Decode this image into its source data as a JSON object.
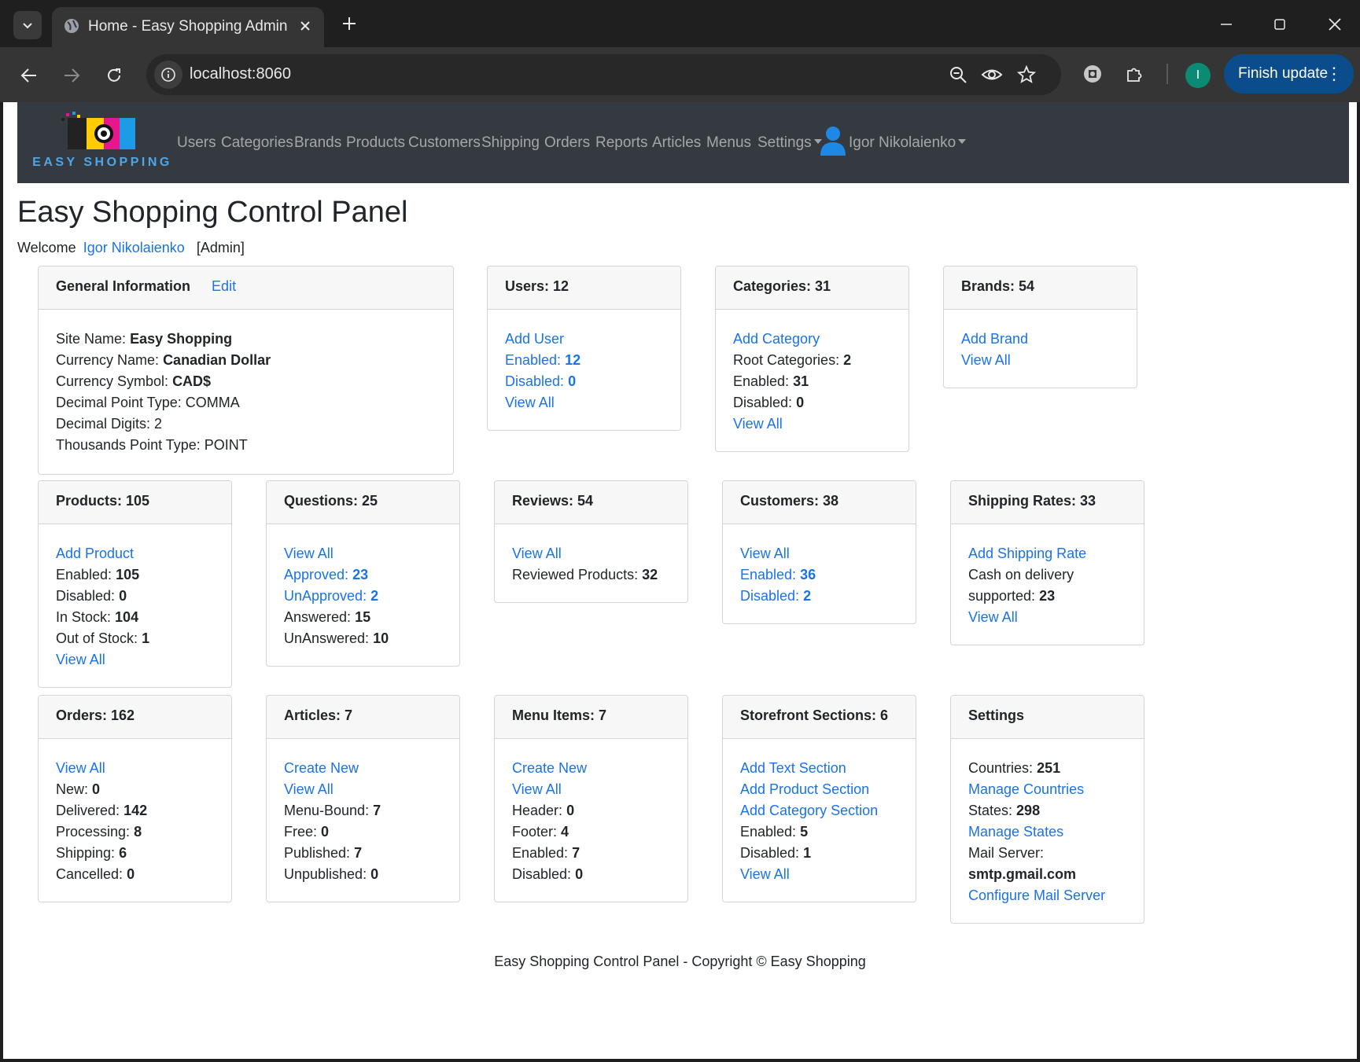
{
  "browser": {
    "tab_title": "Home - Easy Shopping Admin",
    "url": "localhost:8060",
    "profile_initial": "I",
    "finish_update": "Finish update"
  },
  "navbar": {
    "logo_text": "EASY SHOPPING",
    "items": [
      "Users",
      "Categories",
      "Brands",
      "Products",
      "Customers",
      "Shipping",
      "Orders",
      "Reports",
      "Articles",
      "Menus",
      "Settings"
    ],
    "user_name": "Igor Nikolaienko"
  },
  "page": {
    "title": "Easy Shopping Control Panel",
    "welcome_prefix": "Welcome",
    "welcome_user": "Igor Nikolaienko",
    "welcome_role": "[Admin]"
  },
  "cards": {
    "general": {
      "title": "General Information",
      "edit": "Edit",
      "site_name_label": "Site Name:",
      "site_name": "Easy Shopping",
      "currency_name_label": "Currency Name:",
      "currency_name": "Canadian Dollar",
      "currency_symbol_label": "Currency Symbol:",
      "currency_symbol": "CAD$",
      "decimal_point": "Decimal Point Type: COMMA",
      "decimal_digits": "Decimal Digits: 2",
      "thousands_point": "Thousands Point Type: POINT"
    },
    "users": {
      "title": "Users: 12",
      "add": "Add User",
      "enabled_label": "Enabled:",
      "enabled": "12",
      "disabled_label": "Disabled:",
      "disabled": "0",
      "view_all": "View All"
    },
    "categories": {
      "title": "Categories: 31",
      "add": "Add Category",
      "root_label": "Root Categories:",
      "root": "2",
      "enabled_label": "Enabled:",
      "enabled": "31",
      "disabled_label": "Disabled:",
      "disabled": "0",
      "view_all": "View All"
    },
    "brands": {
      "title": "Brands: 54",
      "add": "Add Brand",
      "view_all": "View All"
    },
    "products": {
      "title": "Products: 105",
      "add": "Add Product",
      "enabled_label": "Enabled:",
      "enabled": "105",
      "disabled_label": "Disabled:",
      "disabled": "0",
      "instock_label": "In Stock:",
      "instock": "104",
      "outstock_label": "Out of Stock:",
      "outstock": "1",
      "view_all": "View All"
    },
    "questions": {
      "title": "Questions: 25",
      "view_all": "View All",
      "approved_label": "Approved:",
      "approved": "23",
      "unapproved_label": "UnApproved:",
      "unapproved": "2",
      "answered_label": "Answered:",
      "answered": "15",
      "unanswered_label": "UnAnswered:",
      "unanswered": "10"
    },
    "reviews": {
      "title": "Reviews: 54",
      "view_all": "View All",
      "reviewed_label": "Reviewed Products:",
      "reviewed": "32"
    },
    "customers": {
      "title": "Customers: 38",
      "view_all": "View All",
      "enabled_label": "Enabled:",
      "enabled": "36",
      "disabled_label": "Disabled:",
      "disabled": "2"
    },
    "shipping": {
      "title": "Shipping Rates: 33",
      "add": "Add Shipping Rate",
      "cod_label_1": "Cash on delivery",
      "cod_label_2": "supported:",
      "cod": "23",
      "view_all": "View All"
    },
    "orders": {
      "title": "Orders: 162",
      "view_all": "View All",
      "new_label": "New:",
      "new": "0",
      "delivered_label": "Delivered:",
      "delivered": "142",
      "processing_label": "Processing:",
      "processing": "8",
      "shipping_label": "Shipping:",
      "shipping": "6",
      "cancelled_label": "Cancelled:",
      "cancelled": "0"
    },
    "articles": {
      "title": "Articles: 7",
      "create": "Create New",
      "view_all": "View All",
      "menubound_label": "Menu-Bound:",
      "menubound": "7",
      "free_label": "Free:",
      "free": "0",
      "published_label": "Published:",
      "published": "7",
      "unpublished_label": "Unpublished:",
      "unpublished": "0"
    },
    "menu_items": {
      "title": "Menu Items: 7",
      "create": "Create New",
      "view_all": "View All",
      "header_label": "Header:",
      "header": "0",
      "footer_label": "Footer:",
      "footer": "4",
      "enabled_label": "Enabled:",
      "enabled": "7",
      "disabled_label": "Disabled:",
      "disabled": "0"
    },
    "storefront": {
      "title": "Storefront Sections: 6",
      "add_text": "Add Text Section",
      "add_product": "Add Product Section",
      "add_category": "Add Category Section",
      "enabled_label": "Enabled:",
      "enabled": "5",
      "disabled_label": "Disabled:",
      "disabled": "1",
      "view_all": "View All"
    },
    "settings": {
      "title": "Settings",
      "countries_label": "Countries:",
      "countries": "251",
      "manage_countries": "Manage Countries",
      "states_label": "States:",
      "states": "298",
      "manage_states": "Manage States",
      "mail_label": "Mail Server:",
      "mail": "smtp.gmail.com",
      "configure_mail": "Configure Mail Server"
    }
  },
  "footer": "Easy Shopping Control Panel - Copyright © Easy Shopping"
}
